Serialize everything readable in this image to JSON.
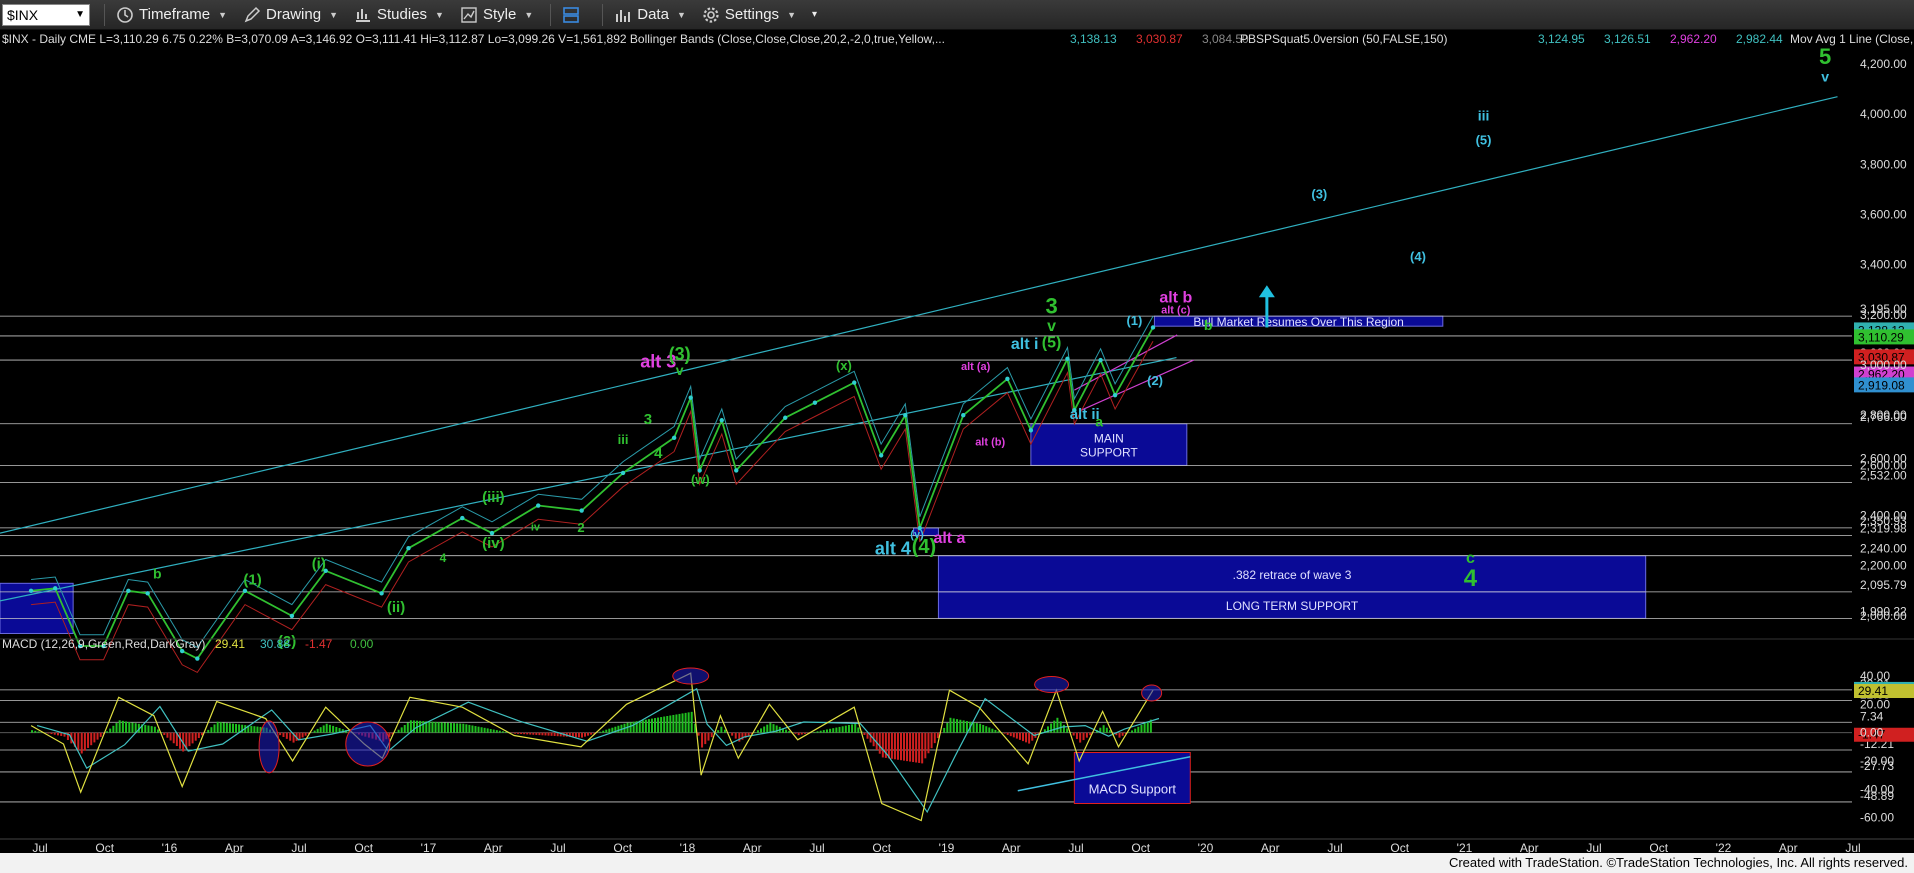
{
  "toolbar": {
    "symbol": "$INX",
    "items": [
      {
        "label": "Timeframe",
        "icon": "clock-icon"
      },
      {
        "label": "Drawing",
        "icon": "pencil-icon"
      },
      {
        "label": "Studies",
        "icon": "studies-icon"
      },
      {
        "label": "Style",
        "icon": "style-icon"
      },
      {
        "label": "Data",
        "icon": "bars-icon"
      },
      {
        "label": "Settings",
        "icon": "gear-icon"
      }
    ]
  },
  "header": {
    "main": "$INX - Daily  CME  L=3,110.29  6.75  0.22%  B=3,070.09  A=3,146.92  O=3,111.41  Hi=3,112.87  Lo=3,099.26  V=1,561,892  Bollinger Bands (Close,Close,Close,20,2,-2,0,true,Yellow,...",
    "bb_values": [
      {
        "v": "3,138.13",
        "c": "#40c0c0"
      },
      {
        "v": "3,030.87",
        "c": "#e03030"
      },
      {
        "v": "3,084.50",
        "c": "#888888"
      }
    ],
    "study2": "PBSPSquat5.0version (50,FALSE,150)",
    "study2_values": [
      {
        "v": "3,124.95",
        "c": "#40c0c0"
      },
      {
        "v": "3,126.51",
        "c": "#40c0c0"
      },
      {
        "v": "2,962.20",
        "c": "#e040e0"
      },
      {
        "v": "2,982.44",
        "c": "#40c0c0"
      }
    ],
    "study3": "Mov Avg 1 Line (Close,..."
  },
  "macd_header": {
    "label": "MACD (12,26,9,Green,Red,DarkGray)",
    "values": [
      {
        "v": "29.41",
        "c": "#e0e040"
      },
      {
        "v": "30.88",
        "c": "#40c0c0"
      },
      {
        "v": "-1.47",
        "c": "#e03030"
      },
      {
        "v": "0.00",
        "c": "#40c040"
      }
    ]
  },
  "chart_data": [
    {
      "type": "line",
      "name": "price",
      "ylim": [
        1900,
        4260
      ],
      "y_ticks": [
        2000,
        2200,
        2400,
        2600,
        2800,
        3000,
        3200,
        3400,
        3600,
        3800,
        4000,
        4200
      ],
      "y_tick_labels": [
        "2,000.00",
        "2,200.00",
        "2,400.00",
        "2,600.00",
        "2,800.00",
        "3,000.00",
        "3,200.00",
        "3,400.00",
        "3,600.00",
        "3,800.00",
        "4,000.00",
        "4,200.00"
      ],
      "x_labels": [
        "Jul",
        "Oct",
        "'16",
        "Apr",
        "Jul",
        "Oct",
        "'17",
        "Apr",
        "Jul",
        "Oct",
        "'18",
        "Apr",
        "Jul",
        "Oct",
        "'19",
        "Apr",
        "Jul",
        "Oct",
        "'20",
        "Apr",
        "Jul",
        "Oct",
        "'21",
        "Apr",
        "Jul",
        "Oct",
        "'22",
        "Apr",
        "Jul"
      ],
      "series": [
        {
          "x": [
            "2015-06-15",
            "2015-07-20",
            "2015-08-25",
            "2015-09-28",
            "2015-11-03",
            "2015-12-01",
            "2016-01-20",
            "2016-02-11",
            "2016-04-20",
            "2016-06-27",
            "2016-08-15",
            "2016-11-04",
            "2016-12-13",
            "2017-03-01",
            "2017-04-13",
            "2017-06-19",
            "2017-08-21",
            "2017-10-20",
            "2018-01-02",
            "2018-01-26",
            "2018-02-08",
            "2018-03-12",
            "2018-04-02",
            "2018-06-12",
            "2018-07-25",
            "2018-09-20",
            "2018-10-29",
            "2018-12-03",
            "2018-12-24",
            "2019-02-25",
            "2019-04-30",
            "2019-06-03",
            "2019-07-26",
            "2019-08-05",
            "2019-09-12",
            "2019-10-03",
            "2019-11-27"
          ],
          "values": [
            2100,
            2110,
            1880,
            1880,
            2100,
            2090,
            1860,
            1830,
            2100,
            2000,
            2180,
            2090,
            2270,
            2390,
            2330,
            2440,
            2420,
            2570,
            2710,
            2870,
            2580,
            2780,
            2580,
            2790,
            2850,
            2930,
            2640,
            2800,
            2350,
            2800,
            2945,
            2740,
            3025,
            2820,
            3020,
            2880,
            3150
          ]
        }
      ],
      "horizontal_levels": [
        {
          "y": 3195.0,
          "label": "3,195.00"
        },
        {
          "y": 3116.1,
          "label": "3,116.10"
        },
        {
          "y": 3020.0,
          "label": "3,020.00"
        },
        {
          "y": 2766.0,
          "label": "2,766.00"
        },
        {
          "y": 2600.0,
          "label": "2,600.00"
        },
        {
          "y": 2532.0,
          "label": "2,532.00"
        },
        {
          "y": 2350.93,
          "label": "2,350.93"
        },
        {
          "y": 2319.98,
          "label": "2,319.98"
        },
        {
          "y": 2240.0,
          "label": "2,240.00"
        },
        {
          "y": 2095.79,
          "label": "2,095.79"
        },
        {
          "y": 1990.22,
          "label": "1,990.22"
        }
      ],
      "price_tags": [
        {
          "y": 3138.13,
          "label": "3,138.13",
          "bg": "#30b0b0"
        },
        {
          "y": 3110.29,
          "label": "3,110.29",
          "bg": "#30c030"
        },
        {
          "y": 3030.87,
          "label": "3,030.87",
          "bg": "#d02020"
        },
        {
          "y": 2962.2,
          "label": "2,962.20",
          "bg": "#d040d0"
        },
        {
          "y": 2919.08,
          "label": "2,919.08",
          "bg": "#3090d0"
        }
      ],
      "zones": [
        {
          "label": "Bull Market Resumes Over This Region",
          "x0": "2019-11-29",
          "x1": "2021-01-20",
          "y0": 3155,
          "y1": 3195
        },
        {
          "label": "MAIN\nSUPPORT",
          "x0": "2019-06-03",
          "x1": "2020-01-15",
          "y0": 2600,
          "y1": 2766
        },
        {
          "label": ".382 retrace of wave 3",
          "x0": "2019-01-20",
          "x1": "2021-11-10",
          "y0": 2095.79,
          "y1": 2240
        },
        {
          "label": "LONG TERM SUPPORT",
          "x0": "2019-01-20",
          "x1": "2021-11-10",
          "y0": 1990.22,
          "y1": 2095.79
        },
        {
          "label": "",
          "x0": "2018-12-15",
          "x1": "2019-01-20",
          "y0": 2319.98,
          "y1": 2350.93
        },
        {
          "label": "",
          "x0": "2015-05-01",
          "x1": "2015-08-15",
          "y0": 1930,
          "y1": 2130
        }
      ],
      "trendlines": [
        {
          "x": [
            "2015-05-01",
            "2022-08-15"
          ],
          "y": [
            2330,
            4070
          ],
          "color": "#30b0c0"
        },
        {
          "x": [
            "2015-05-01",
            "2019-12-31"
          ],
          "y": [
            2060,
            3030
          ],
          "color": "#30b0c0"
        },
        {
          "x": [
            "2019-08-05",
            "2020-01-01"
          ],
          "y": [
            2900,
            3120
          ],
          "color": "#d040d0"
        },
        {
          "x": [
            "2019-08-15",
            "2020-01-25"
          ],
          "y": [
            2820,
            3020
          ],
          "color": "#d040d0"
        }
      ],
      "wave_labels": [
        {
          "t": "5",
          "x": "2022-07-28",
          "y": 4200,
          "c": "#30c030",
          "s": 22
        },
        {
          "t": "v",
          "x": "2022-07-28",
          "y": 4130,
          "c": "#40c0e0",
          "s": 14
        },
        {
          "t": "iii",
          "x": "2021-03-20",
          "y": 3975,
          "c": "#40c0e0",
          "s": 14
        },
        {
          "t": "(5)",
          "x": "2021-03-20",
          "y": 3880,
          "c": "#40c0e0",
          "s": 13
        },
        {
          "t": "(3)",
          "x": "2020-07-25",
          "y": 3665,
          "c": "#40c0e0",
          "s": 13
        },
        {
          "t": "(4)",
          "x": "2020-12-15",
          "y": 3415,
          "c": "#40c0e0",
          "s": 13
        },
        {
          "t": "alt b",
          "x": "2019-12-30",
          "y": 3250,
          "c": "#e040e0",
          "s": 16
        },
        {
          "t": "alt (c)",
          "x": "2019-12-30",
          "y": 3205,
          "c": "#e040e0",
          "s": 11
        },
        {
          "t": "b",
          "x": "2020-02-15",
          "y": 3140,
          "c": "#30c030",
          "s": 14
        },
        {
          "t": "(1)",
          "x": "2019-10-31",
          "y": 3160,
          "c": "#40c0e0",
          "s": 13
        },
        {
          "t": "(2)",
          "x": "2019-11-30",
          "y": 2920,
          "c": "#40c0e0",
          "s": 13
        },
        {
          "t": "3",
          "x": "2019-07-03",
          "y": 3205,
          "c": "#30c030",
          "s": 22
        },
        {
          "t": "v",
          "x": "2019-07-03",
          "y": 3135,
          "c": "#30c030",
          "s": 16
        },
        {
          "t": "(5)",
          "x": "2019-07-03",
          "y": 3070,
          "c": "#30c030",
          "s": 16
        },
        {
          "t": "alt i",
          "x": "2019-05-25",
          "y": 3065,
          "c": "#40c0e0",
          "s": 16
        },
        {
          "t": "alt ii",
          "x": "2019-08-20",
          "y": 2785,
          "c": "#40c0e0",
          "s": 15
        },
        {
          "t": "a",
          "x": "2019-09-10",
          "y": 2755,
          "c": "#30c030",
          "s": 14
        },
        {
          "t": "alt (a)",
          "x": "2019-03-15",
          "y": 2980,
          "c": "#e040e0",
          "s": 11
        },
        {
          "t": "alt (b)",
          "x": "2019-04-05",
          "y": 2680,
          "c": "#e040e0",
          "s": 11
        },
        {
          "t": "(x)",
          "x": "2018-09-05",
          "y": 2980,
          "c": "#30c030",
          "s": 13
        },
        {
          "t": "(w)",
          "x": "2018-02-09",
          "y": 2525,
          "c": "#30c030",
          "s": 13
        },
        {
          "t": "alt 3",
          "x": "2017-12-10",
          "y": 2990,
          "c": "#e040e0",
          "s": 18
        },
        {
          "t": "(3)",
          "x": "2018-01-10",
          "y": 3020,
          "c": "#30c030",
          "s": 18
        },
        {
          "t": "v",
          "x": "2018-01-10",
          "y": 2960,
          "c": "#30c030",
          "s": 14
        },
        {
          "t": "3",
          "x": "2017-11-25",
          "y": 2765,
          "c": "#30c030",
          "s": 15
        },
        {
          "t": "4",
          "x": "2017-12-10",
          "y": 2630,
          "c": "#30c030",
          "s": 15
        },
        {
          "t": "iii",
          "x": "2017-10-20",
          "y": 2685,
          "c": "#30c030",
          "s": 13
        },
        {
          "t": "(y)",
          "x": "2018-12-20",
          "y": 2310,
          "c": "#40c0e0",
          "s": 11
        },
        {
          "t": "alt 4",
          "x": "2018-11-15",
          "y": 2245,
          "c": "#40c0e0",
          "s": 18
        },
        {
          "t": "(4)",
          "x": "2018-12-30",
          "y": 2250,
          "c": "#30c030",
          "s": 20
        },
        {
          "t": "alt a",
          "x": "2019-02-05",
          "y": 2290,
          "c": "#e040e0",
          "s": 16
        },
        {
          "t": "c",
          "x": "2021-03-01",
          "y": 2210,
          "c": "#30c030",
          "s": 16
        },
        {
          "t": "4",
          "x": "2021-03-01",
          "y": 2120,
          "c": "#30c030",
          "s": 24
        },
        {
          "t": "(iii)",
          "x": "2017-04-15",
          "y": 2455,
          "c": "#30c030",
          "s": 15
        },
        {
          "t": "(iv)",
          "x": "2017-04-15",
          "y": 2270,
          "c": "#30c030",
          "s": 15
        },
        {
          "t": "iv",
          "x": "2017-06-15",
          "y": 2340,
          "c": "#30c030",
          "s": 11
        },
        {
          "t": "2",
          "x": "2017-08-20",
          "y": 2335,
          "c": "#30c030",
          "s": 13
        },
        {
          "t": "4",
          "x": "2017-02-01",
          "y": 2215,
          "c": "#30c030",
          "s": 12
        },
        {
          "t": "(ii)",
          "x": "2016-11-25",
          "y": 2015,
          "c": "#30c030",
          "s": 15
        },
        {
          "t": "(1)",
          "x": "2016-05-01",
          "y": 2125,
          "c": "#30c030",
          "s": 15
        },
        {
          "t": "(i)",
          "x": "2016-08-05",
          "y": 2190,
          "c": "#30c030",
          "s": 15
        },
        {
          "t": "(2)",
          "x": "2016-06-20",
          "y": 1880,
          "c": "#30c030",
          "s": 15
        },
        {
          "t": "b",
          "x": "2015-12-15",
          "y": 2150,
          "c": "#30c030",
          "s": 14
        }
      ],
      "arrow": {
        "x": "2020-05-10",
        "y0": 3150,
        "y1": 3310,
        "color": "#20c0e0"
      }
    },
    {
      "type": "bar",
      "name": "macd",
      "ylim": [
        -68,
        52
      ],
      "y_ticks": [
        -60,
        -40,
        -20,
        0,
        20,
        40
      ],
      "y_tick_labels": [
        "-60.00",
        "-40.00",
        "-20.00",
        "0.00",
        "20.00",
        "40.00"
      ],
      "horizontal_levels": [
        {
          "y": 30.21,
          "label": "30.21"
        },
        {
          "y": 22.63,
          "label": "22.63"
        },
        {
          "y": 7.34,
          "label": "7.34"
        },
        {
          "y": -12.21,
          "label": "-12.21"
        },
        {
          "y": -27.73,
          "label": "-27.73"
        },
        {
          "y": -48.89,
          "label": "-48.89"
        }
      ],
      "price_tags": [
        {
          "y": 30.88,
          "label": "30.88",
          "bg": "#30b0b0"
        },
        {
          "y": 29.41,
          "label": "29.41",
          "bg": "#c0c030"
        },
        {
          "y": -1.47,
          "label": "-1.47",
          "bg": "#d02020"
        }
      ],
      "zones": [
        {
          "label": "MACD Support",
          "x0": "2019-08-05",
          "x1": "2020-01-20",
          "y0": -50,
          "y1": -14
        }
      ],
      "series": [
        {
          "name": "macd",
          "x": [
            "2015-06-15",
            "2015-08-01",
            "2015-08-26",
            "2015-10-20",
            "2015-12-10",
            "2016-01-20",
            "2016-03-10",
            "2016-05-20",
            "2016-06-28",
            "2016-08-15",
            "2016-10-10",
            "2016-11-05",
            "2016-12-15",
            "2017-03-01",
            "2017-05-15",
            "2017-08-20",
            "2017-10-25",
            "2018-01-26",
            "2018-02-10",
            "2018-03-10",
            "2018-04-05",
            "2018-05-20",
            "2018-06-30",
            "2018-09-20",
            "2018-10-30",
            "2018-12-26",
            "2019-02-05",
            "2019-03-20",
            "2019-05-30",
            "2019-07-10",
            "2019-08-12",
            "2019-09-15",
            "2019-10-08",
            "2019-11-27"
          ],
          "values": [
            5,
            -8,
            -42,
            25,
            12,
            -38,
            22,
            10,
            -20,
            18,
            -8,
            -18,
            25,
            18,
            -2,
            -10,
            20,
            42,
            -30,
            12,
            -18,
            20,
            -5,
            18,
            -50,
            -62,
            30,
            18,
            -22,
            30,
            -20,
            15,
            -10,
            30
          ]
        }
      ],
      "circles": [
        {
          "x": "2016-05-25",
          "y": -10,
          "rx": 10,
          "ry": 26
        },
        {
          "x": "2016-10-15",
          "y": -8,
          "rx": 22,
          "ry": 22
        },
        {
          "x": "2018-01-26",
          "y": 40,
          "rx": 18,
          "ry": 8
        },
        {
          "x": "2019-07-03",
          "y": 34,
          "rx": 17,
          "ry": 8
        },
        {
          "x": "2019-11-25",
          "y": 28,
          "rx": 10,
          "ry": 8
        }
      ],
      "trendlines": [
        {
          "x": [
            "2019-05-15",
            "2020-01-20"
          ],
          "y": [
            -41,
            -17
          ],
          "color": "#40c0e0"
        }
      ]
    }
  ],
  "footer": "Created with TradeStation. ©TradeStation Technologies, Inc. All rights reserved."
}
